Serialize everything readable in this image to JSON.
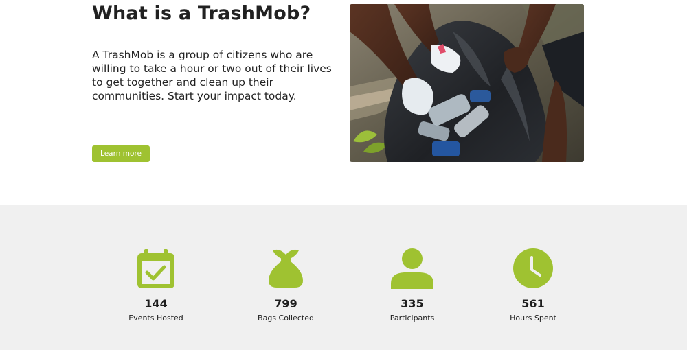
{
  "hero": {
    "title": "What is a TrashMob?",
    "body": "A TrashMob is a group of citizens who are willing to take a hour or two out of their lives to get together and clean up their communities. Start your impact today.",
    "cta_label": "Learn more"
  },
  "stats": {
    "events": {
      "value": "144",
      "label": "Events Hosted",
      "icon": "calendar-check-icon"
    },
    "bags": {
      "value": "799",
      "label": "Bags Collected",
      "icon": "trash-bag-icon"
    },
    "participants": {
      "value": "335",
      "label": "Participants",
      "icon": "person-icon"
    },
    "hours": {
      "value": "561",
      "label": "Hours Spent",
      "icon": "clock-icon"
    }
  },
  "colors": {
    "accent": "#9fc231",
    "stats_background": "#f0f0f0",
    "text": "#1e1e1e"
  }
}
